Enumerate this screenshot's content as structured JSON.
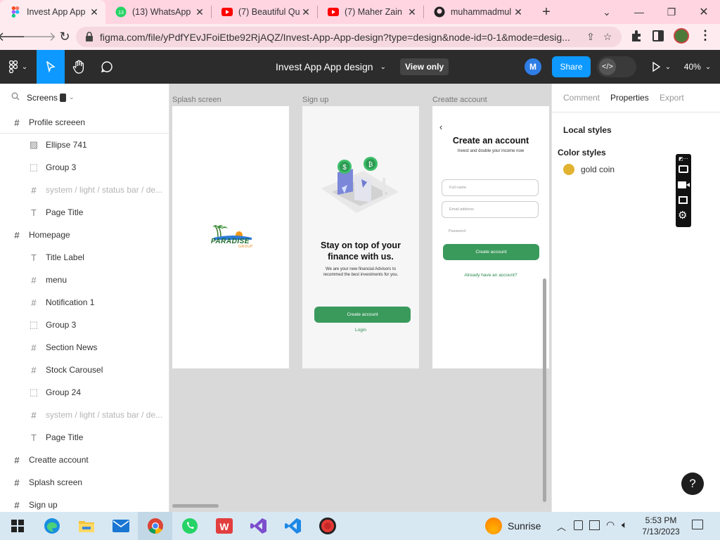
{
  "browser": {
    "tabs": [
      {
        "title": "Invest App App",
        "icon": "figma-icon",
        "active": true
      },
      {
        "title": "(13) WhatsApp",
        "icon": "whatsapp-icon",
        "badge": "13",
        "active": false
      },
      {
        "title": "(7) Beautiful Qu",
        "icon": "youtube-icon",
        "active": false
      },
      {
        "title": "(7) Maher Zain",
        "icon": "youtube-icon",
        "active": false
      },
      {
        "title": "muhammadmul",
        "icon": "github-icon",
        "active": false
      }
    ],
    "url": "figma.com/file/yPdfYEvJFoiEtbe92RjAQZ/Invest-App-App-design?type=design&node-id=0-1&mode=desig..."
  },
  "figma": {
    "file_title": "Invest App App design",
    "view_only_label": "View only",
    "avatar_initial": "M",
    "share_label": "Share",
    "zoom": "40%"
  },
  "left_panel": {
    "pages_label": "Screens",
    "layers": [
      {
        "label": "Profile screeen",
        "icon": "frame-icon",
        "level": 0
      },
      {
        "label": "Ellipse 741",
        "icon": "image-icon",
        "level": 1
      },
      {
        "label": "Group 3",
        "icon": "group-icon",
        "level": 1
      },
      {
        "label": "system / light / status bar / de...",
        "icon": "frame-icon",
        "level": 1,
        "dim": true
      },
      {
        "label": "Page Title",
        "icon": "text-icon",
        "level": 1
      },
      {
        "label": "Homepage",
        "icon": "frame-icon",
        "level": 0
      },
      {
        "label": "Title Label",
        "icon": "text-icon",
        "level": 1
      },
      {
        "label": "menu",
        "icon": "frame-icon",
        "level": 1
      },
      {
        "label": "Notification 1",
        "icon": "frame-icon",
        "level": 1
      },
      {
        "label": "Group 3",
        "icon": "group-icon",
        "level": 1
      },
      {
        "label": "Section News",
        "icon": "frame-icon",
        "level": 1
      },
      {
        "label": "Stock Carousel",
        "icon": "frame-icon",
        "level": 1
      },
      {
        "label": "Group 24",
        "icon": "group-icon",
        "level": 1
      },
      {
        "label": "system / light / status bar / de...",
        "icon": "frame-icon",
        "level": 1,
        "dim": true
      },
      {
        "label": "Page Title",
        "icon": "text-icon",
        "level": 1
      },
      {
        "label": "Creatte account",
        "icon": "frame-icon",
        "level": 0
      },
      {
        "label": "Splash screen",
        "icon": "frame-icon",
        "level": 0
      },
      {
        "label": "Sign up",
        "icon": "frame-icon",
        "level": 0
      }
    ]
  },
  "canvas": {
    "frames": {
      "splash": {
        "label": "Splash screen",
        "logo_main": "PARADISE",
        "logo_sub": "GROUP"
      },
      "signup": {
        "label": "Sign up",
        "headline": "Stay on top of your finance with us.",
        "body": "We are your new financial Advisors to recommed the best investments for you.",
        "cta": "Create account",
        "login": "Login"
      },
      "create": {
        "label": "Creatte account",
        "back": "‹",
        "title": "Create an account",
        "subtitle": "Invest and double your income now",
        "fullname_placeholder": "Full name",
        "email_placeholder": "Email address",
        "password_placeholder": "Password",
        "cta": "Create account",
        "already": "Already have an account?"
      }
    }
  },
  "right_panel": {
    "tabs": [
      "Comment",
      "Properties",
      "Export"
    ],
    "active_tab": "Properties",
    "local_styles": "Local styles",
    "color_styles": "Color styles",
    "styles": [
      {
        "name": "gold coin",
        "color": "#E2B331"
      }
    ],
    "help": "?"
  },
  "taskbar": {
    "weather": "Sunrise",
    "time": "5:53 PM",
    "date": "7/13/2023"
  },
  "colors": {
    "accent_green": "#3a9a5c",
    "share_blue": "#0d99ff",
    "tab_strip": "#ffd5e2"
  }
}
